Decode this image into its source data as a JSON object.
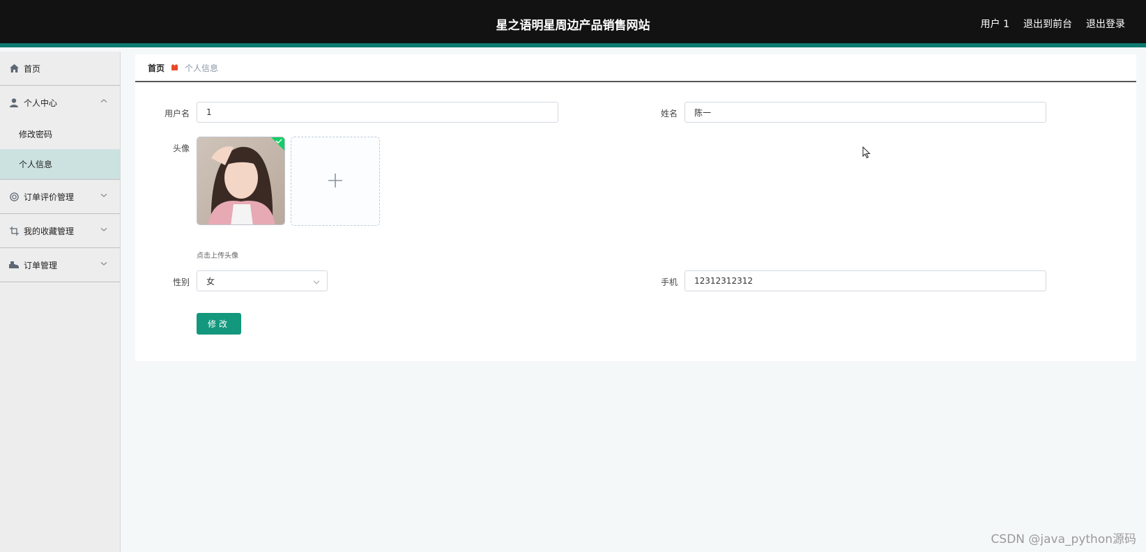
{
  "header": {
    "title": "星之语明星周边产品销售网站",
    "user_label": "用户 1",
    "back_to_front": "退出到前台",
    "logout": "退出登录"
  },
  "sidebar": {
    "home": "首页",
    "personal_center": "个人中心",
    "change_password": "修改密码",
    "personal_info": "个人信息",
    "order_review_mgmt": "订单评价管理",
    "favorites_mgmt": "我的收藏管理",
    "order_mgmt": "订单管理"
  },
  "breadcrumb": {
    "home": "首页",
    "current": "个人信息"
  },
  "form": {
    "username_label": "用户名",
    "username_value": "1",
    "name_label": "姓名",
    "name_value": "陈一",
    "avatar_label": "头像",
    "upload_tip": "点击上传头像",
    "gender_label": "性别",
    "gender_value": "女",
    "phone_label": "手机",
    "phone_value": "12312312312",
    "submit_label": "修改"
  },
  "watermark": "CSDN @java_python源码",
  "colors": {
    "accent": "#13977d",
    "topbar": "#121212",
    "topbar_border": "#0d7a72",
    "active_menu": "#cce2e1"
  }
}
